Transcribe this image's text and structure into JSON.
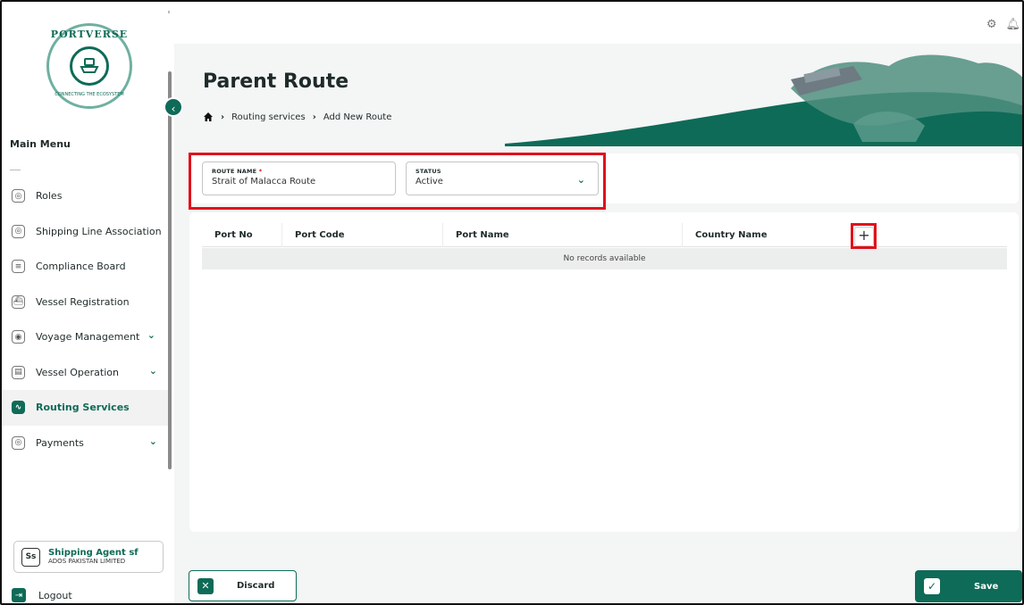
{
  "brand": {
    "logo_text_top": "PORTVERSE",
    "logo_text_bottom": "CONNECTING THE ECOSYSTEM",
    "accent": "#0e6b57"
  },
  "sidebar": {
    "menu_title": "Main Menu",
    "items": [
      {
        "label": "Roles",
        "icon": "roles-icon",
        "has_chevron": false,
        "active": false
      },
      {
        "label": "Shipping Line Association",
        "icon": "association-icon",
        "has_chevron": false,
        "active": false
      },
      {
        "label": "Compliance Board",
        "icon": "document-icon",
        "has_chevron": false,
        "active": false
      },
      {
        "label": "Vessel Registration",
        "icon": "ship-icon",
        "has_chevron": false,
        "active": false
      },
      {
        "label": "Voyage Management",
        "icon": "voyage-icon",
        "has_chevron": true,
        "active": false
      },
      {
        "label": "Vessel Operation",
        "icon": "vessel-operation-icon",
        "has_chevron": true,
        "active": false
      },
      {
        "label": "Routing Services",
        "icon": "routing-icon",
        "has_chevron": false,
        "active": true
      },
      {
        "label": "Payments",
        "icon": "payments-icon",
        "has_chevron": true,
        "active": false
      }
    ],
    "user": {
      "initials": "Ss",
      "name": "Shipping Agent sf",
      "org": "ADOS PAKISTAN LIMITED"
    },
    "logout_label": "Logout"
  },
  "header": {
    "title": "Parent Route",
    "breadcrumb": [
      "Routing services",
      "Add New Route"
    ]
  },
  "form": {
    "route_name": {
      "label": "ROUTE NAME",
      "required_mark": "*",
      "value": "Strait of Malacca Route"
    },
    "status": {
      "label": "STATUS",
      "value": "Active"
    }
  },
  "table": {
    "columns": [
      "Port No",
      "Port Code",
      "Port Name",
      "Country Name"
    ],
    "add_label": "+",
    "empty_text": "No records available"
  },
  "footer": {
    "discard_label": "Discard",
    "save_label": "Save"
  }
}
